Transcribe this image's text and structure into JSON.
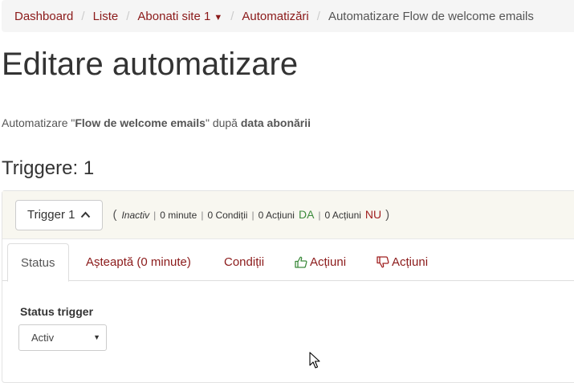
{
  "breadcrumb": {
    "items": [
      "Dashboard",
      "Liste",
      "Abonati site 1",
      "Automatizări"
    ],
    "current": "Automatizare Flow de welcome emails",
    "separator": "/"
  },
  "page_title": "Editare automatizare",
  "summary": {
    "prefix": "Automatizare \"",
    "name": "Flow de welcome emails",
    "middle": "\" după ",
    "basis": "data abonării"
  },
  "triggers_title": "Triggere: 1",
  "trigger": {
    "button_label": "Trigger 1",
    "info": {
      "open_paren": "(",
      "state": "Inactiv",
      "wait": "0 minute",
      "conditions": "0 Condiții",
      "actions_yes": "0 Acțiuni",
      "yes_label": "DA",
      "actions_no": "0 Acțiuni",
      "no_label": "NU",
      "close_paren": ")"
    }
  },
  "tabs": {
    "status": "Status",
    "wait": "Așteaptă (0 minute)",
    "conditions": "Condiții",
    "actions_yes": "Acțiuni",
    "actions_no": "Acțiuni"
  },
  "status_form": {
    "label": "Status trigger",
    "selected": "Activ"
  },
  "colors": {
    "link": "#8b1a1a",
    "yes": "#3d8b3d",
    "no": "#a02020"
  }
}
